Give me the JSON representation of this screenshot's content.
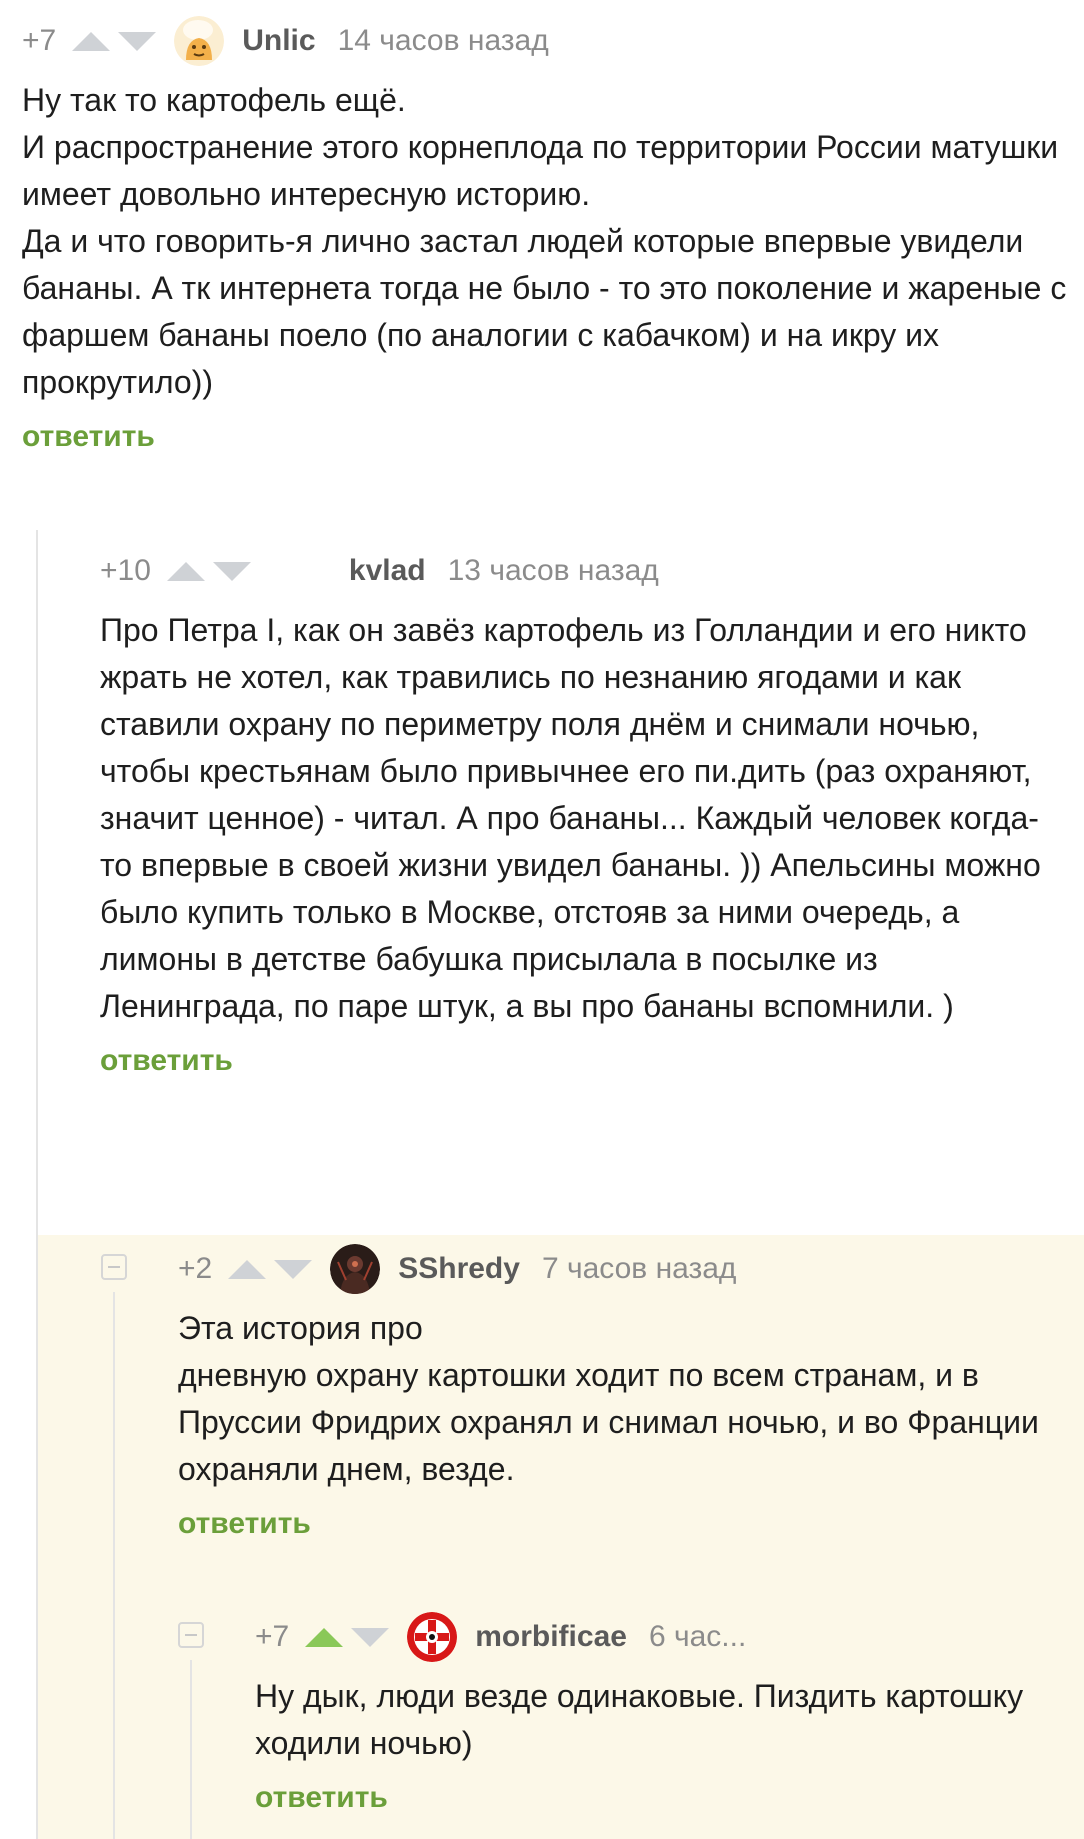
{
  "comments": [
    {
      "rating": "+7",
      "author": "Unlic",
      "time": "14 часов назад",
      "avatar_icon": "cartoon-avatar-icon",
      "lines": [
        "Ну так то картофель ещё.",
        "И распространение этого корнеплода по территории России матушки имеет довольно интересную историю.",
        "Да и что говорить-я лично застал людей которые впервые увидели бананы. А тк интернета тогда не было - то это поколение и жареные с фаршем бананы поело (по аналогии с кабачком) и на икру их прокрутило))"
      ],
      "reply_label": "ответить"
    },
    {
      "rating": "+10",
      "author": "kvlad",
      "time": "13 часов назад",
      "avatar_icon": "",
      "lines": [
        "Про Петра I, как он завёз картофель из Голландии и его никто жрать не хотел, как травились по незнанию ягодами и как ставили охрану по периметру поля днём и снимали ночью, чтобы крестьянам было привычнее его пи.дить (раз охраняют, значит ценное) - читал. А про бананы... Каждый человек когда-то впервые в своей жизни увидел бананы. )) Апельсины можно было купить только в Москве, отстояв за ними очередь, а лимоны в детстве бабушка присылала в посылке из Ленинграда, по паре штук, а вы про бананы вспомнили. )"
      ],
      "reply_label": "ответить"
    },
    {
      "rating": "+2",
      "author": "SShredy",
      "time": "7 часов назад",
      "avatar_icon": "dark-figure-avatar-icon",
      "lines": [
        "Эта история про",
        "дневную охрану картошки ходит по всем странам, и в Пруссии Фридрих охранял и снимал ночью, и во Франции охраняли днем, везде."
      ],
      "reply_label": "ответить"
    },
    {
      "rating": "+7",
      "author": "morbificae",
      "time": "6 час...",
      "avatar_icon": "red-cross-emblem-avatar-icon",
      "lines": [
        "Ну дык, люди везде одинаковые. Пиздить картошку ходили ночью)"
      ],
      "reply_label": "ответить"
    }
  ],
  "colors": {
    "reply_link": "#6b9f3a",
    "active_upvote": "#8ac858",
    "inactive_vote": "#cfd2d6",
    "highlight_bg": "#fcf8e8"
  }
}
